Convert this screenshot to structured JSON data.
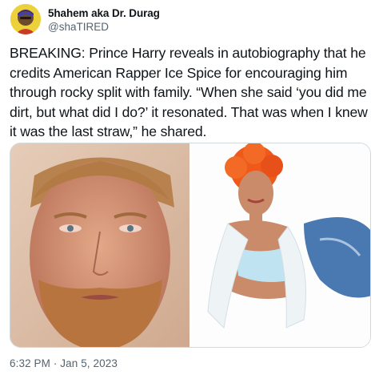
{
  "tweet": {
    "display_name": "5hahem aka Dr. Durag",
    "handle": "@shaTIRED",
    "text": "BREAKING: Prince Harry reveals in autobiography that he credits American Rapper Ice Spice for encouraging him through rocky split with family. “When she said ‘you did me dirt, but what did I do?’ it resonated. That was when I knew it was the last straw,” he shared.",
    "timestamp": "6:32 PM · Jan 5, 2023"
  },
  "icons": {
    "avatar": "avatar-icon"
  },
  "colors": {
    "text": "#0f1419",
    "secondary": "#536471",
    "border": "#cfd9de",
    "avatar_bg": "#ecd13a"
  }
}
